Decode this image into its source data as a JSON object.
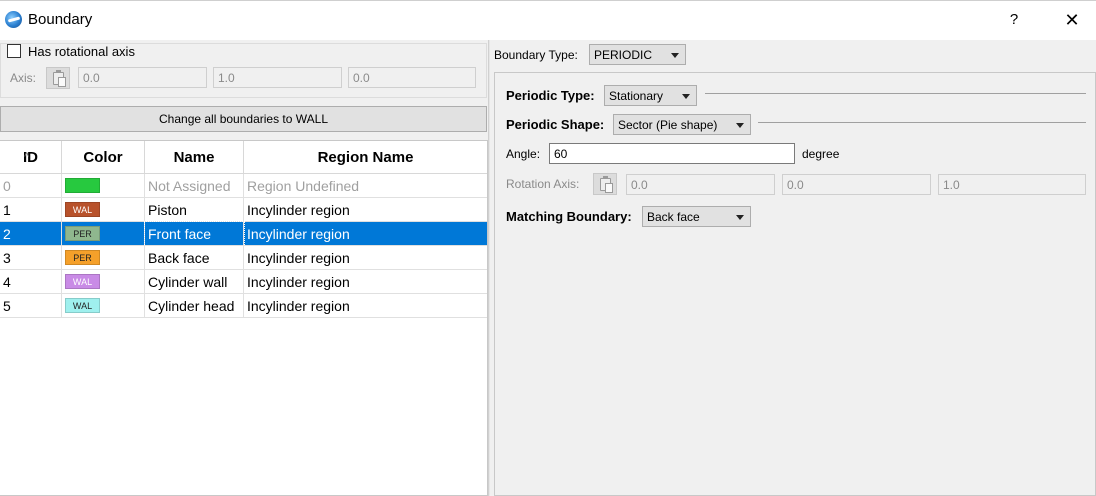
{
  "window": {
    "title": "Boundary",
    "help_label": "?",
    "close_label": "✕"
  },
  "rotational": {
    "checkbox_label": "Has rotational axis",
    "checked": false,
    "axis_label": "Axis:",
    "axis_values": [
      "0.0",
      "1.0",
      "0.0"
    ]
  },
  "change_all_button": "Change all boundaries to WALL",
  "table": {
    "headers": {
      "id": "ID",
      "color": "Color",
      "name": "Name",
      "region": "Region Name"
    },
    "sort_indicator": "^",
    "rows": [
      {
        "id": "0",
        "swatch_color": "#27c93f",
        "tag": "",
        "name": "Not Assigned",
        "region": "Region Undefined",
        "disabled": true,
        "selected": false
      },
      {
        "id": "1",
        "swatch_color": "#b8522b",
        "tag": "WAL",
        "name": "Piston",
        "region": "Incylinder region",
        "disabled": false,
        "selected": false
      },
      {
        "id": "2",
        "swatch_color": "#8fb78e",
        "tag": "PER",
        "name": "Front face",
        "region": "Incylinder region",
        "disabled": false,
        "selected": true
      },
      {
        "id": "3",
        "swatch_color": "#f5a02a",
        "tag": "PER",
        "name": "Back face",
        "region": "Incylinder region",
        "disabled": false,
        "selected": false
      },
      {
        "id": "4",
        "swatch_color": "#c98be6",
        "tag": "WAL",
        "name": "Cylinder wall",
        "region": "Incylinder region",
        "disabled": false,
        "selected": false
      },
      {
        "id": "5",
        "swatch_color": "#9ff0ee",
        "tag": "WAL",
        "name": "Cylinder head",
        "region": "Incylinder region",
        "disabled": false,
        "selected": false
      }
    ]
  },
  "boundary_type": {
    "label": "Boundary Type:",
    "value": "PERIODIC"
  },
  "periodic": {
    "type_label": "Periodic Type:",
    "type_value": "Stationary",
    "shape_label": "Periodic Shape:",
    "shape_value": "Sector (Pie shape)",
    "angle_label": "Angle:",
    "angle_value": "60",
    "angle_unit": "degree",
    "rotation_axis_label": "Rotation Axis:",
    "rotation_axis_values": [
      "0.0",
      "0.0",
      "1.0"
    ],
    "matching_label": "Matching Boundary:",
    "matching_value": "Back face"
  },
  "colors": {
    "selection": "#0078d7",
    "disabled_text": "#a0a0a0"
  }
}
